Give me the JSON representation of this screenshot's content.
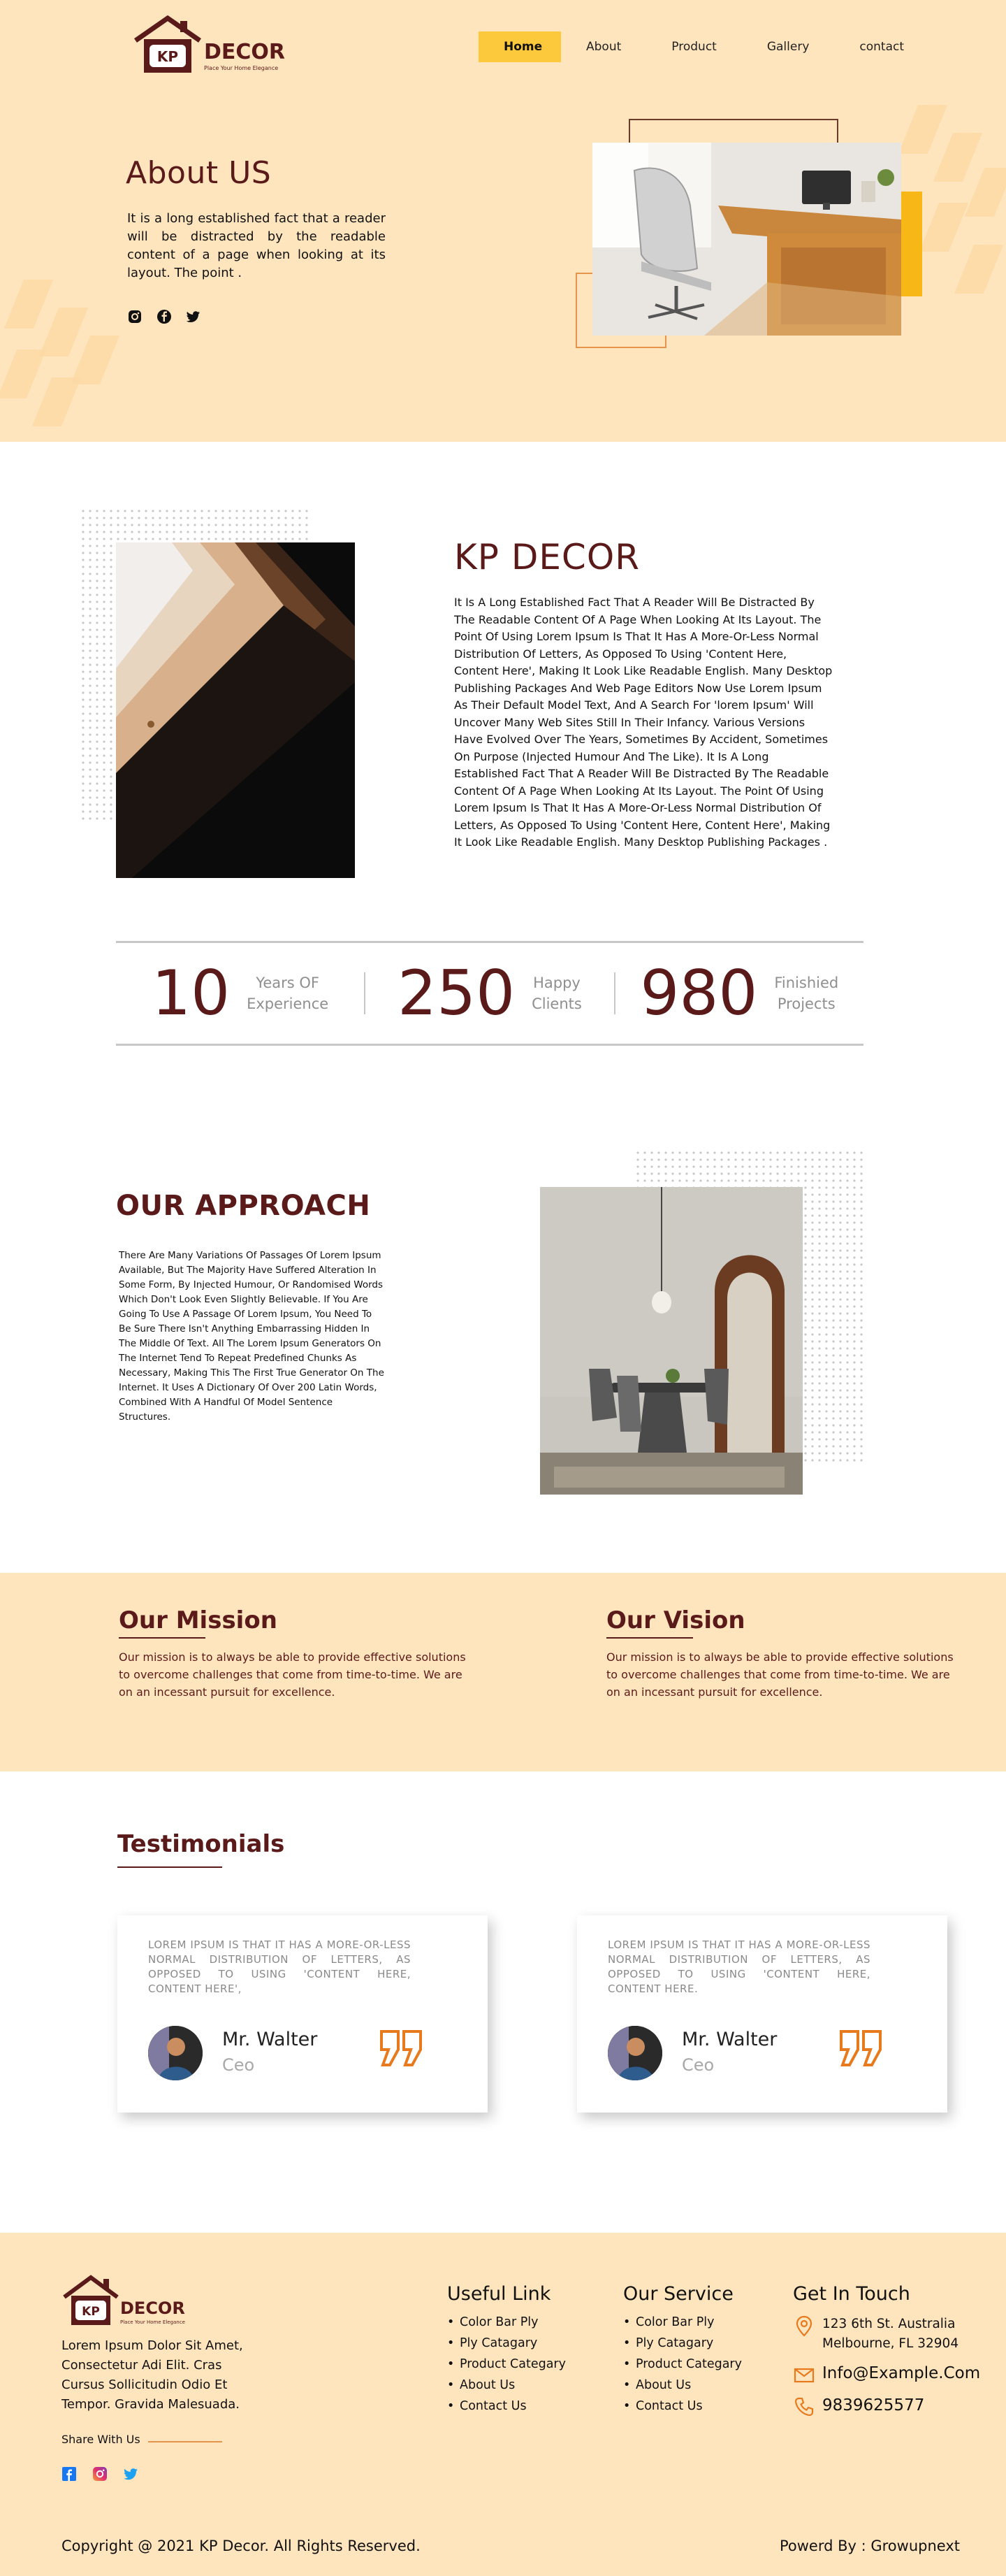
{
  "brand": {
    "logo_letters": "KP",
    "name": "DECOR",
    "tagline": "Place Your Home Elegance"
  },
  "nav": {
    "items": [
      "Home",
      "About",
      "Product",
      "Gallery",
      "contact"
    ],
    "active": "Home"
  },
  "hero": {
    "title": "About US",
    "text": "It is a long established fact that a reader will be distracted by the readable content of a page when looking at its layout. The point .",
    "socials": [
      "instagram-icon",
      "facebook-icon",
      "twitter-icon"
    ]
  },
  "about": {
    "title": "KP DECOR",
    "text": "It Is A Long Established Fact That A Reader Will Be Distracted By The Readable Content Of A Page When Looking At Its Layout. The Point Of Using Lorem Ipsum Is That It Has A More-Or-Less Normal Distribution Of Letters, As Opposed To Using 'Content Here, Content Here', Making It Look Like Readable English. Many Desktop Publishing Packages And Web Page Editors Now Use Lorem Ipsum As Their Default Model Text, And A Search For 'lorem Ipsum' Will Uncover Many Web Sites Still In Their Infancy. Various Versions Have Evolved Over The Years, Sometimes By Accident, Sometimes On Purpose (Injected Humour And The Like).  It Is A Long Established Fact That A Reader Will Be Distracted By The Readable Content Of A Page When Looking At Its Layout. The Point Of Using Lorem Ipsum Is That It Has A More-Or-Less Normal Distribution Of Letters, As Opposed To Using 'Content Here, Content Here', Making It Look Like Readable English. Many Desktop Publishing Packages ."
  },
  "stats": [
    {
      "value": "10",
      "label_line1": "Years OF",
      "label_line2": "Experience"
    },
    {
      "value": "250",
      "label_line1": "Happy",
      "label_line2": "Clients"
    },
    {
      "value": "980",
      "label_line1": "Finishied",
      "label_line2": "Projects"
    }
  ],
  "approach": {
    "title": "OUR APPROACH",
    "text": "There Are Many Variations Of Passages Of Lorem Ipsum Available, But The Majority Have Suffered Alteration In Some Form, By Injected Humour, Or Randomised Words Which Don't Look Even Slightly Believable. If You Are Going To Use A Passage Of Lorem Ipsum, You Need To Be Sure There Isn't Anything Embarrassing Hidden In The Middle Of Text. All The Lorem Ipsum Generators On The Internet Tend To Repeat Predefined Chunks As Necessary, Making This The First True Generator On The Internet. It Uses A Dictionary Of Over 200 Latin Words, Combined With A Handful Of Model Sentence Structures."
  },
  "mission": {
    "title": "Our Mission",
    "text": "Our mission is to always be able to provide effective solutions to overcome challenges that come from time-to-time. We are on an incessant pursuit for excellence."
  },
  "vision": {
    "title": "Our Vision",
    "text": "Our mission is to always be able to provide effective solutions to overcome challenges that come from time-to-time. We are on an incessant pursuit for excellence."
  },
  "testimonials": {
    "title": "Testimonials",
    "items": [
      {
        "quote": "LOREM IPSUM IS THAT IT HAS A MORE-OR-LESS NORMAL DISTRIBUTION OF LETTERS, AS OPPOSED TO USING 'CONTENT HERE, CONTENT HERE',",
        "name": "Mr. Walter",
        "role": "Ceo"
      },
      {
        "quote": "LOREM IPSUM IS THAT IT HAS A MORE-OR-LESS NORMAL DISTRIBUTION OF LETTERS, AS OPPOSED TO USING 'CONTENT HERE, CONTENT HERE.",
        "name": "Mr. Walter",
        "role": "Ceo"
      }
    ]
  },
  "footer": {
    "about": "Lorem Ipsum Dolor Sit Amet, Consectetur Adi Elit. Cras Cursus Sollicitudin Odio Et Tempor. Gravida Malesuada.",
    "share_label": "Share With Us",
    "useful_title": "Useful Link",
    "useful_links": [
      "Color Bar Ply",
      "Ply Catagary",
      "Product Categary",
      "About Us",
      "Contact Us"
    ],
    "service_title": "Our Service",
    "service_links": [
      "Color Bar Ply",
      "Ply Catagary",
      "Product Categary",
      "About Us",
      "Contact Us"
    ],
    "contact_title": "Get In Touch",
    "address_line1": "123 6th St. Australia",
    "address_line2": "Melbourne, FL 32904",
    "email": "Info@Example.Com",
    "phone": "9839625577",
    "copyright": "Copyright @ 2021 KP Decor. All Rights Reserved.",
    "powered": "Powerd By : Growupnext"
  },
  "colors": {
    "cream": "#ffe5bd",
    "brand_brown": "#5a1a1a",
    "nav_active": "#fcc93c",
    "accent_orange": "#e5944b"
  }
}
